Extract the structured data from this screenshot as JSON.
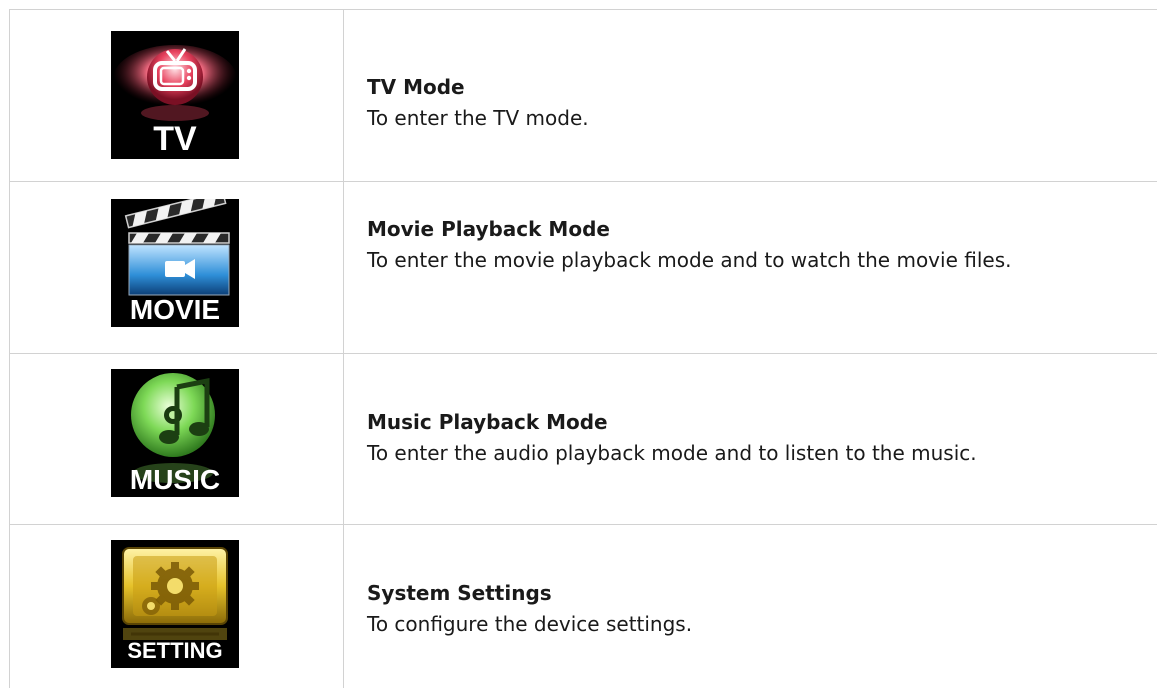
{
  "rows": [
    {
      "icon_name": "tv-icon",
      "icon_label": "TV",
      "title": "TV Mode",
      "description": "To enter the TV mode."
    },
    {
      "icon_name": "movie-icon",
      "icon_label": "MOVIE",
      "title": "Movie Playback Mode",
      "description": "To enter the movie playback mode and to watch the movie files."
    },
    {
      "icon_name": "music-icon",
      "icon_label": "MUSIC",
      "title": "Music Playback Mode",
      "description": "To enter the audio playback mode and to listen to the music."
    },
    {
      "icon_name": "setting-icon",
      "icon_label": "SETTING",
      "title": "System Settings",
      "description": "To configure the device settings."
    }
  ],
  "colors": {
    "tv_accent": "#e8425e",
    "movie_accent": "#2f8fd8",
    "music_accent": "#7ed957",
    "setting_accent": "#e6c22a",
    "grid_line": "#d2d2d2"
  }
}
